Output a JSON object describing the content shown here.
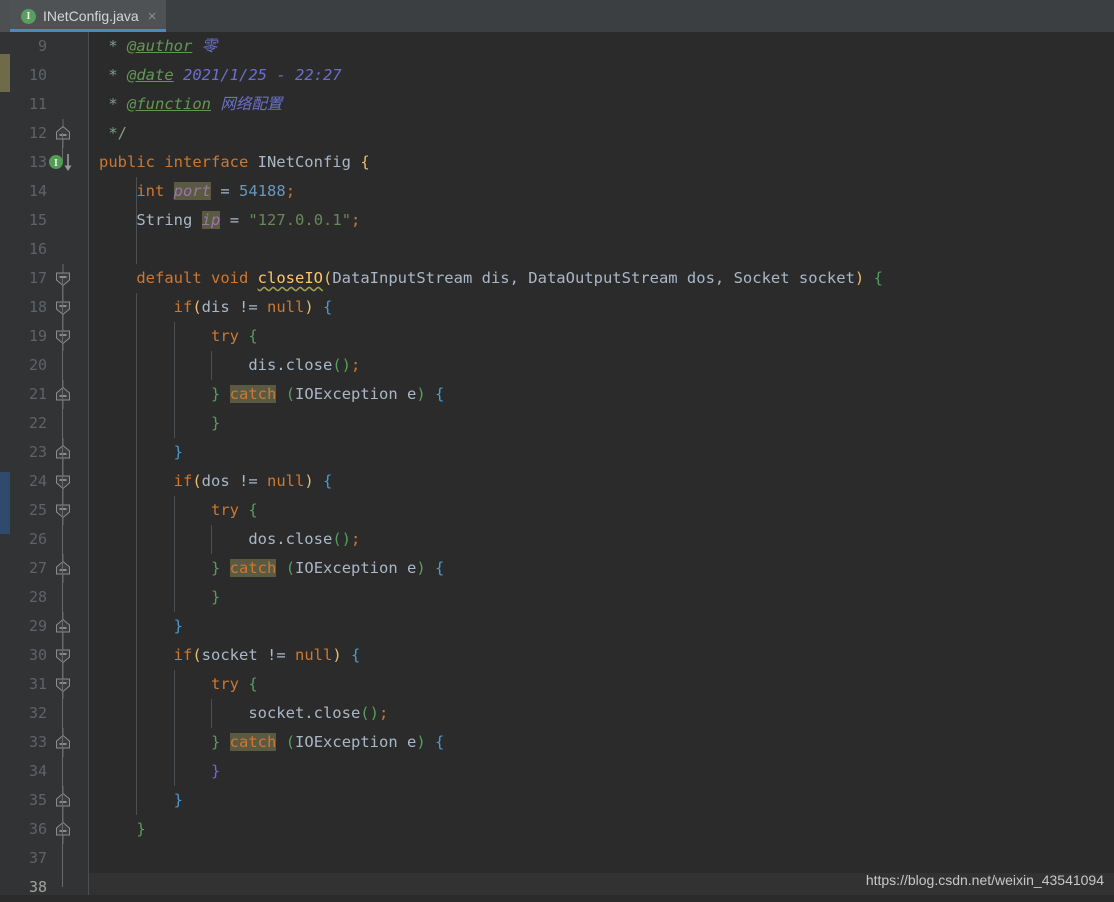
{
  "tab": {
    "icon": "interface-icon",
    "icon_letter": "I",
    "filename": "INetConfig.java",
    "close": "×"
  },
  "editor": {
    "first_line": 9,
    "caret_line": 38,
    "gutter_icon_line": 13,
    "gutter_icon": "implemented-method-icon",
    "watermark": "https://blog.csdn.net/weixin_43541094",
    "colors": {
      "background": "#2b2b2b",
      "gutter": "#313335",
      "tabbar": "#3c3f41",
      "tab_active": "#4e5254",
      "tab_underline": "#4a88c7",
      "keyword": "#cc7832",
      "identifier": "#a9b7c6",
      "string": "#6a8759",
      "number": "#6897bb",
      "comment_tag": "#629755",
      "comment_value": "#6a70c9",
      "field": "#9876aa",
      "method": "#ffc66d",
      "highlight": "#5a5a42",
      "caret_row": "#323232"
    }
  },
  "lines": [
    {
      "n": 9,
      "text": " * @author 零"
    },
    {
      "n": 10,
      "text": " * @date 2021/1/25 - 22:27"
    },
    {
      "n": 11,
      "text": " * @function 网络配置"
    },
    {
      "n": 12,
      "text": " */"
    },
    {
      "n": 13,
      "text": "public interface INetConfig {"
    },
    {
      "n": 14,
      "text": "    int port = 54188;"
    },
    {
      "n": 15,
      "text": "    String ip = \"127.0.0.1\";"
    },
    {
      "n": 16,
      "text": ""
    },
    {
      "n": 17,
      "text": "    default void closeIO(DataInputStream dis, DataOutputStream dos, Socket socket) {"
    },
    {
      "n": 18,
      "text": "        if(dis != null) {"
    },
    {
      "n": 19,
      "text": "            try {"
    },
    {
      "n": 20,
      "text": "                dis.close();"
    },
    {
      "n": 21,
      "text": "            } catch (IOException e) {"
    },
    {
      "n": 22,
      "text": "            }"
    },
    {
      "n": 23,
      "text": "        }"
    },
    {
      "n": 24,
      "text": "        if(dos != null) {"
    },
    {
      "n": 25,
      "text": "            try {"
    },
    {
      "n": 26,
      "text": "                dos.close();"
    },
    {
      "n": 27,
      "text": "            } catch (IOException e) {"
    },
    {
      "n": 28,
      "text": "            }"
    },
    {
      "n": 29,
      "text": "        }"
    },
    {
      "n": 30,
      "text": "        if(socket != null) {"
    },
    {
      "n": 31,
      "text": "            try {"
    },
    {
      "n": 32,
      "text": "                socket.close();"
    },
    {
      "n": 33,
      "text": "            } catch (IOException e) {"
    },
    {
      "n": 34,
      "text": "            }"
    },
    {
      "n": 35,
      "text": "        }"
    },
    {
      "n": 36,
      "text": "    }"
    },
    {
      "n": 37,
      "text": ""
    },
    {
      "n": 38,
      "text": ""
    }
  ],
  "javadoc": {
    "author_tag": "@author",
    "author_value": "零",
    "date_tag": "@date",
    "date_value": "2021/1/25 - 22:27",
    "function_tag": "@function",
    "function_value": "网络配置",
    "close": "*/"
  },
  "declaration": {
    "mod": "public",
    "kind": "interface",
    "name": "INetConfig",
    "port_type": "int",
    "port_name": "port",
    "port_value": "54188",
    "ip_type": "String",
    "ip_name": "ip",
    "ip_value": "\"127.0.0.1\""
  },
  "method": {
    "mod": "default",
    "ret": "void",
    "name": "closeIO",
    "params": "DataInputStream dis, DataOutputStream dos, Socket socket",
    "keyword_if": "if",
    "keyword_null": "null",
    "keyword_try": "try",
    "keyword_catch": "catch",
    "exception": "IOException e",
    "vars": [
      "dis",
      "dos",
      "socket"
    ],
    "call": "close()"
  }
}
